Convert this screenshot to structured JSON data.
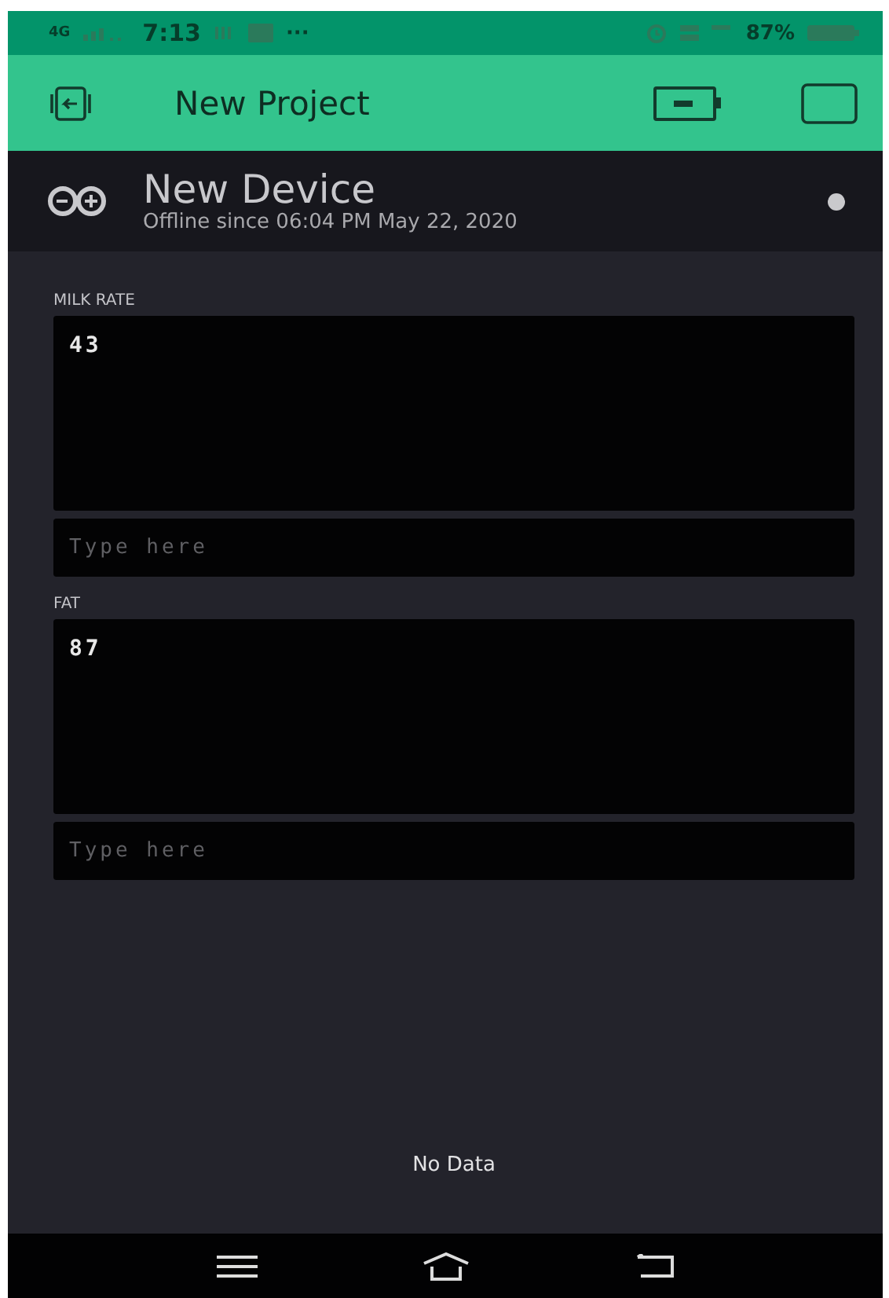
{
  "status_bar": {
    "network": "4G",
    "time": "7:13",
    "more": "···",
    "battery": "87%"
  },
  "header": {
    "title": "New Project"
  },
  "device": {
    "name": "New Device",
    "status": "Offline since 06:04 PM May 22, 2020",
    "online": false
  },
  "widgets": [
    {
      "label": "MILK RATE",
      "value": "43",
      "placeholder": "Type here"
    },
    {
      "label": "FAT",
      "value": "87",
      "placeholder": "Type here"
    }
  ],
  "chart": {
    "message": "No Data"
  }
}
